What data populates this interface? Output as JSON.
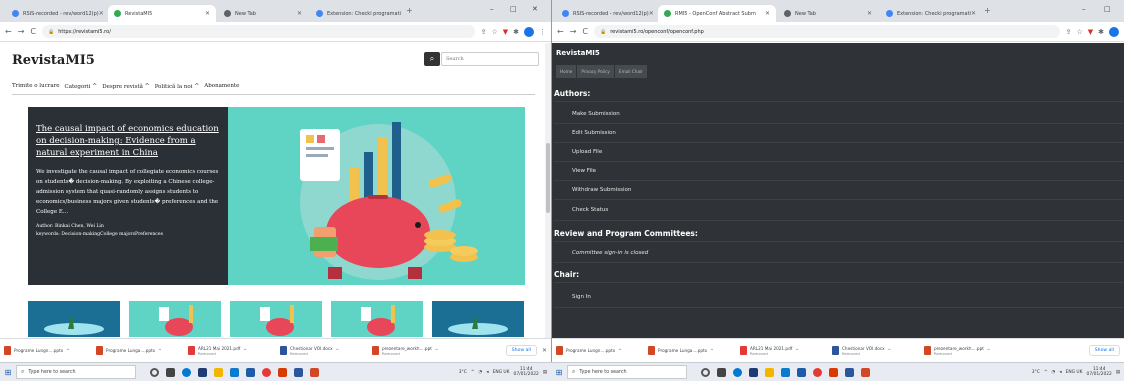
{
  "left": {
    "tabs": [
      {
        "label": "RSIS-recorded - rev/word12(p)",
        "active": false,
        "favicon_color": "#4285f4"
      },
      {
        "label": "RevistaMI5",
        "active": true,
        "favicon_color": "#34a853"
      },
      {
        "label": "New Tab",
        "active": false,
        "favicon_color": "#5f6368"
      },
      {
        "label": "Extension: Checki programati",
        "active": false,
        "favicon_color": "#4285f4"
      }
    ],
    "window_controls": [
      "–",
      "□",
      "✕"
    ],
    "url": "https://revistami5.ro/",
    "site_title": "RevistaMI5",
    "search_placeholder": "Search",
    "menu": [
      {
        "label": "Trimite o lucrare",
        "caret": false
      },
      {
        "label": "Categorii",
        "caret": true
      },
      {
        "label": "Despre revistă",
        "caret": true
      },
      {
        "label": "Politică la noi",
        "caret": true
      },
      {
        "label": "Abonamente",
        "caret": false
      }
    ],
    "article": {
      "title": "The causal impact of economics education on decision-making: Evidence from a natural experiment in China",
      "abstract": "We investigate the causal impact of collegiate economics courses on students� decision-making. By exploiting a Chinese college-admission system that quasi-randomly assigns students to economics/business majors given students� preferences and the College E...",
      "authors": "Author: Binkai Chen, Wei Lin",
      "keywords": "keywords: Decision-makingCollege majorsPreferences"
    }
  },
  "right": {
    "tabs": [
      {
        "label": "RSIS-recorded - rev/word12(p)",
        "active": false,
        "favicon_color": "#4285f4"
      },
      {
        "label": "RMI5 - OpenConf Abstract Subm",
        "active": true,
        "favicon_color": "#34a853"
      },
      {
        "label": "New Tab",
        "active": false,
        "favicon_color": "#5f6368"
      },
      {
        "label": "Extension: Checki programati",
        "active": false,
        "favicon_color": "#4285f4"
      }
    ],
    "url": "revistami5.ro/openconf/openconf.php",
    "site_title": "RevistaMI5",
    "nav": [
      "Home",
      "Privacy Policy",
      "Email Chair"
    ],
    "authors_heading": "Authors:",
    "authors_items": [
      "Make Submission",
      "Edit Submission",
      "Upload File",
      "View File",
      "Withdraw Submission",
      "Check Status"
    ],
    "committee_heading": "Review and Program Committees:",
    "committee_note": "Committee sign-in is closed",
    "chair_heading": "Chair:",
    "chair_items": [
      "Sign In"
    ]
  },
  "downloads": [
    {
      "name": "Programe Lungn....pptx",
      "sub": "",
      "color": "#d24726"
    },
    {
      "name": "Programe Lunga....pptx",
      "sub": "",
      "color": "#d24726"
    },
    {
      "name": "ARL21 Mai 2021.pdf",
      "sub": "Removed",
      "color": "#e53935"
    },
    {
      "name": "Chestionar VOI.docx",
      "sub": "Removed",
      "color": "#2b579a"
    },
    {
      "name": "prezentare_workh....ppt",
      "sub": "Removed",
      "color": "#d24726"
    }
  ],
  "show_all": "Show all",
  "taskbar": {
    "search_placeholder": "Type here to search",
    "weather": "3°C",
    "lang": "ENG\nUK",
    "time": "11:44",
    "date": "07/01/2022",
    "app_colors": [
      "#555",
      "#444",
      "#0078d4",
      "#1f3b73",
      "#f2b600",
      "#0a7bcf",
      "#1f5aa6",
      "#d83b01",
      "#e53935",
      "#2b579a",
      "#d24726"
    ]
  }
}
